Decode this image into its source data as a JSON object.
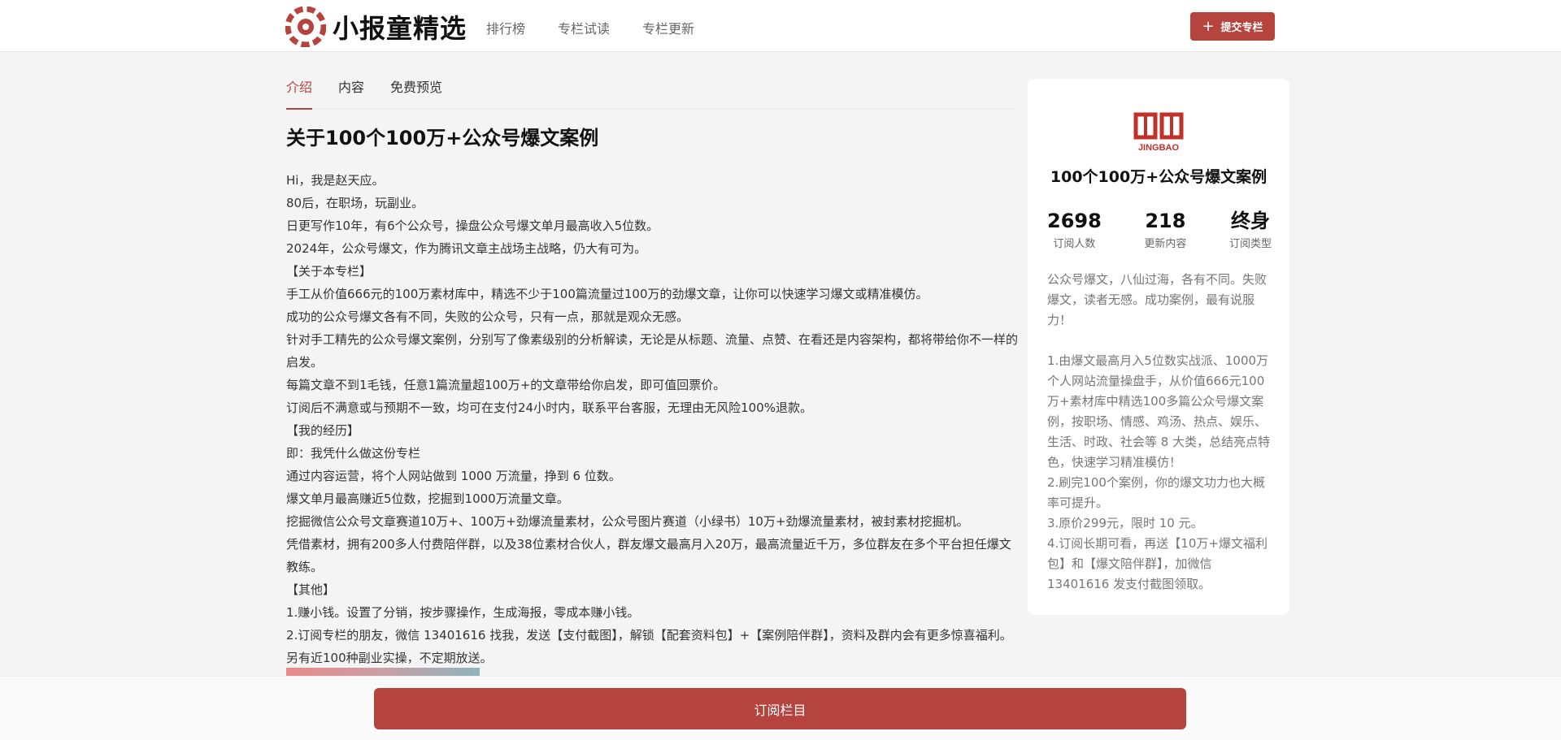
{
  "header": {
    "logo_text": "小报童精选",
    "nav": [
      "排行榜",
      "专栏试读",
      "专栏更新"
    ],
    "submit_label": "提交专栏"
  },
  "tabs": [
    "介绍",
    "内容",
    "免费预览"
  ],
  "article": {
    "title": "关于100个100万+公众号爆文案例",
    "paragraphs": [
      "Hi，我是赵天应。",
      "80后，在职场，玩副业。",
      "日更写作10年，有6个公众号，操盘公众号爆文单月最高收入5位数。",
      "2024年，公众号爆文，作为腾讯文章主战场主战略，仍大有可为。",
      "【关于本专栏】",
      "手工从价值666元的100万素材库中，精选不少于100篇流量过100万的劲爆文章，让你可以快速学习爆文或精准模仿。",
      "成功的公众号爆文各有不同，失败的公众号，只有一点，那就是观众无感。",
      "针对手工精先的公众号爆文案例，分别写了像素级别的分析解读，无论是从标题、流量、点赞、在看还是内容架构，都将带给你不一样的启发。",
      "每篇文章不到1毛钱，任意1篇流量超100万+的文章带给你启发，即可值回票价。",
      "订阅后不满意或与预期不一致，均可在支付24小时内，联系平台客服，无理由无风险100%退款。",
      "【我的经历】",
      "即：我凭什么做这份专栏",
      "通过内容运营，将个人网站做到 1000 万流量，挣到 6 位数。",
      "爆文单月最高赚近5位数，挖掘到1000万流量文章。",
      "挖掘微信公众号文章赛道10万+、100万+劲爆流量素材，公众号图片赛道（小绿书）10万+劲爆流量素材，被封素材挖掘机。",
      "凭借素材，拥有200多人付费陪伴群，以及38位素材合伙人，群友爆文最高月入20万，最高流量近千万，多位群友在多个平台担任爆文教练。",
      "【其他】",
      "1.赚小钱。设置了分销，按步骤操作，生成海报，零成本赚小钱。",
      "2.订阅专栏的朋友，微信 13401616 找我，发送【支付截图】，解锁【配套资料包】+【案例陪伴群】，资料及群内会有更多惊喜福利。另有近100种副业实操，不定期放送。"
    ]
  },
  "sidebar": {
    "brand_name": "JINGBAO",
    "title": "100个100万+公众号爆文案例",
    "stats": [
      {
        "value": "2698",
        "label": "订阅人数"
      },
      {
        "value": "218",
        "label": "更新内容"
      },
      {
        "value": "终身",
        "label": "订阅类型"
      }
    ],
    "desc_intro": "公众号爆文，八仙过海，各有不同。失败爆文，读者无感。成功案例，最有说服力！",
    "desc_points": [
      "1.由爆文最高月入5位数实战派、1000万个人网站流量操盘手，从价值666元100万+素材库中精选100多篇公众号爆文案例，按职场、情感、鸡汤、热点、娱乐、生活、时政、社会等 8 大类，总结亮点特色，快速学习精准模仿！",
      "2.刷完100个案例，你的爆文功力也大概率可提升。",
      "3.原价299元，限时 10 元。",
      "4.订阅长期可看，再送【10万+爆文福利包】和【爆文陪伴群】，加微信 13401616 发支付截图领取。"
    ]
  },
  "subscribe_label": "订阅栏目",
  "colors": {
    "accent": "#b5443e"
  }
}
